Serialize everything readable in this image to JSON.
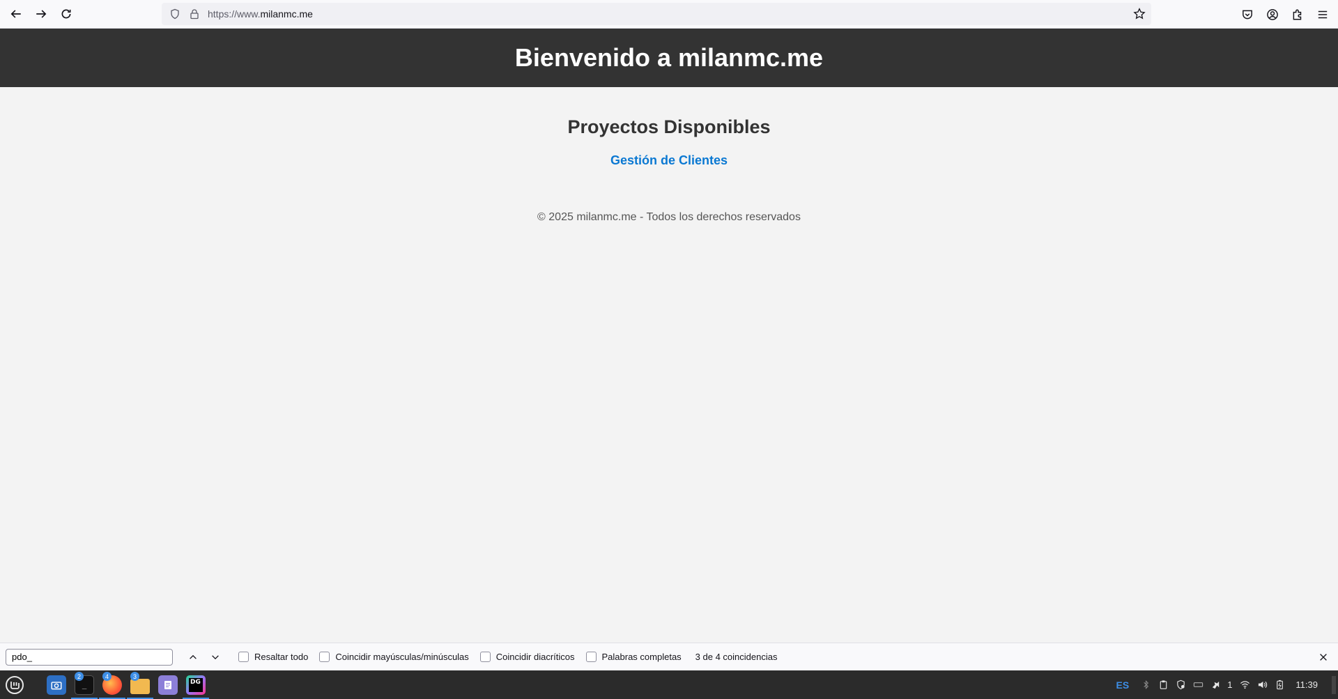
{
  "browser": {
    "url_scheme": "https://www.",
    "url_host": "milanmc.me"
  },
  "page": {
    "header_title": "Bienvenido a milanmc.me",
    "section_title": "Proyectos Disponibles",
    "project_link": "Gestión de Clientes",
    "footer": "© 2025 milanmc.me - Todos los derechos reservados"
  },
  "findbar": {
    "query": "pdo_",
    "options": [
      "Resaltar todo",
      "Coincidir mayúsculas/minúsculas",
      "Coincidir diacríticos",
      "Palabras completas"
    ],
    "match_status": "3 de 4 coincidencias"
  },
  "taskbar": {
    "badges": {
      "terminal": "2",
      "firefox": "4",
      "files": "3"
    },
    "language": "ES",
    "notification_count": "1",
    "clock": "11:39"
  },
  "colors": {
    "header_bg": "#333333",
    "page_bg": "#f3f3f3",
    "link": "#0a78d2",
    "taskbar_bg": "#2b2b2b",
    "accent": "#3d8ee6"
  }
}
